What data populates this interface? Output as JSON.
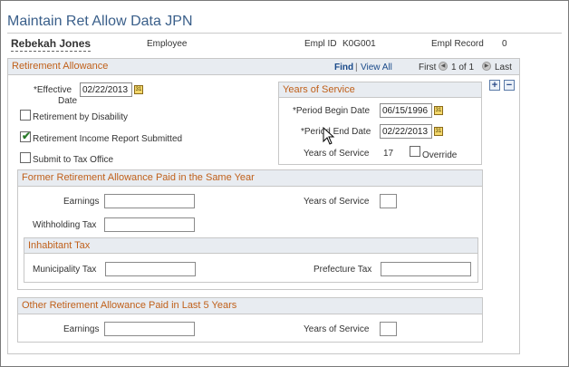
{
  "page": {
    "title": "Maintain Ret Allow Data JPN"
  },
  "header": {
    "employee_name": "Rebekah Jones",
    "employee_label": "Employee",
    "empl_id_label": "Empl ID",
    "empl_id_value": "K0G001",
    "empl_record_label": "Empl Record",
    "empl_record_value": "0"
  },
  "retirement_allowance": {
    "title": "Retirement Allowance",
    "nav": {
      "find": "Find",
      "separator": "|",
      "view_all": "View All",
      "first": "First",
      "range": "1 of 1",
      "last": "Last"
    },
    "effective_date_label_1": "*Effective",
    "effective_date_label_2": "Date",
    "effective_date_value": "02/22/2013",
    "checkboxes": [
      {
        "label": "Retirement by Disability",
        "checked": false
      },
      {
        "label": "Retirement Income Report Submitted",
        "checked": true
      },
      {
        "label": "Submit to Tax Office",
        "checked": false
      }
    ],
    "add_symbol": "+",
    "delete_symbol": "−"
  },
  "years_of_service": {
    "title": "Years of Service",
    "period_begin_label": "*Period Begin Date",
    "period_begin_value": "06/15/1996",
    "period_end_label": "*Period End Date",
    "period_end_value": "02/22/2013",
    "years_label": "Years of Service",
    "years_value": "17",
    "override_label": "Override"
  },
  "former_allowance": {
    "title": "Former Retirement Allowance Paid in the Same Year",
    "earnings_label": "Earnings",
    "earnings_value": "",
    "years_label": "Years of Service",
    "years_value": "",
    "withholding_label": "Withholding Tax",
    "withholding_value": ""
  },
  "inhabitant_tax": {
    "title": "Inhabitant Tax",
    "municipality_label": "Municipality Tax",
    "municipality_value": "",
    "prefecture_label": "Prefecture Tax",
    "prefecture_value": ""
  },
  "other_allowance": {
    "title": "Other Retirement Allowance Paid in Last 5 Years",
    "earnings_label": "Earnings",
    "earnings_value": "",
    "years_label": "Years of Service",
    "years_value": ""
  },
  "icons": {
    "calendar": "calendar-icon",
    "nav_prev": "nav-previous-icon",
    "nav_next": "nav-next-icon",
    "cursor": "mouse-pointer-icon"
  },
  "colors": {
    "title": "#3a5f8a",
    "group_title": "#c0601a",
    "group_header_bg": "#e8ecf1",
    "link": "#1a4a8a",
    "check": "#2a7a2a"
  }
}
